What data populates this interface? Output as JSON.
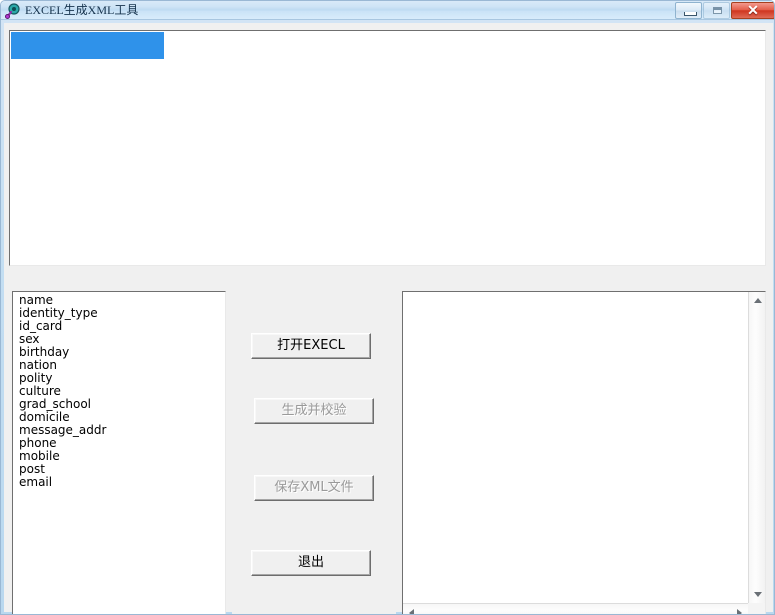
{
  "window": {
    "title": "EXCEL生成XML工具",
    "app_icon": "app-icon",
    "controls": {
      "minimize_label": "–",
      "maximize_label": "□",
      "close_label": "✕"
    },
    "colors": {
      "titlebar_accent": "#c4def2",
      "close_button": "#cf3620",
      "selection_blue": "#2f92ea",
      "client_background": "#f0f0f0"
    }
  },
  "sheet_panel": {
    "selected_item_label": "",
    "items": [
      ""
    ]
  },
  "field_list": {
    "items": [
      "name",
      "identity_type",
      "id_card",
      "sex",
      "birthday",
      "nation",
      "polity",
      "culture",
      "grad_school",
      "domicile",
      "message_addr",
      "phone",
      "mobile",
      "post",
      "email"
    ]
  },
  "buttons": {
    "open_excel": {
      "label": "打开EXECL",
      "enabled": true
    },
    "generate_verify": {
      "label": "生成并校验",
      "enabled": false
    },
    "save_xml": {
      "label": "保存XML文件",
      "enabled": false
    },
    "exit": {
      "label": "退出",
      "enabled": true
    }
  },
  "output_panel": {
    "text": "",
    "scroll_up_icon": "triangle-up-icon",
    "scroll_down_icon": "triangle-down-icon",
    "scroll_left_icon": "triangle-left-icon",
    "scroll_right_icon": "triangle-right-icon"
  }
}
